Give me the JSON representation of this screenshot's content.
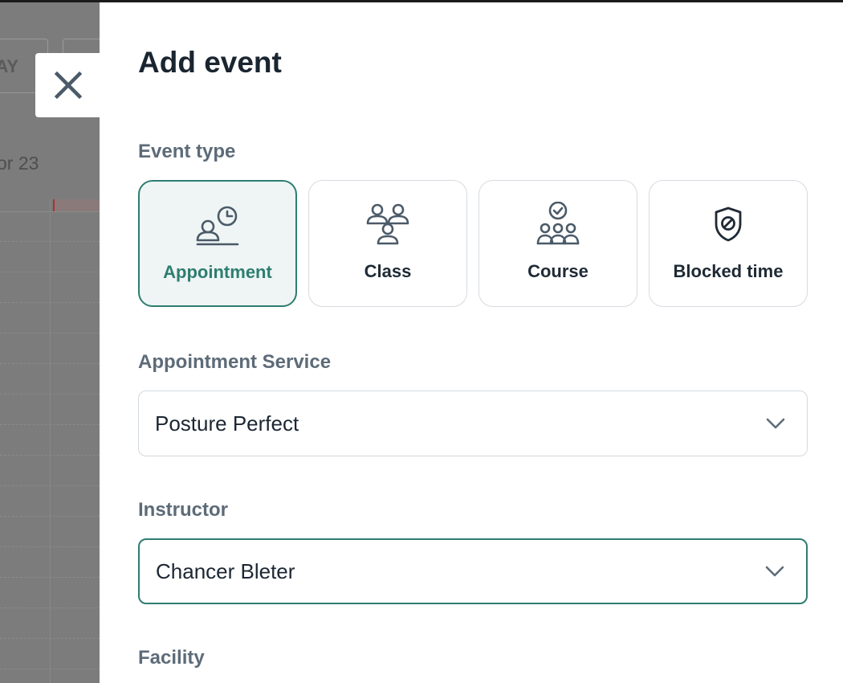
{
  "backdrop": {
    "view_button_label": "AY",
    "date_label": "or 23"
  },
  "drawer": {
    "title": "Add event",
    "event_type": {
      "label": "Event type",
      "options": [
        {
          "label": "Appointment",
          "icon": "person-clock-icon",
          "selected": true
        },
        {
          "label": "Class",
          "icon": "group-icon",
          "selected": false
        },
        {
          "label": "Course",
          "icon": "group-check-icon",
          "selected": false
        },
        {
          "label": "Blocked time",
          "icon": "shield-block-icon",
          "selected": false
        }
      ]
    },
    "appointment_service": {
      "label": "Appointment Service",
      "value": "Posture Perfect"
    },
    "instructor": {
      "label": "Instructor",
      "value": "Chancer Bleter"
    },
    "facility": {
      "label": "Facility"
    }
  },
  "colors": {
    "accent": "#2e7d71",
    "selected_bg": "#eef5f4",
    "title": "#1a2530",
    "label": "#5d6b78",
    "overlay": "#7a7a7a"
  }
}
